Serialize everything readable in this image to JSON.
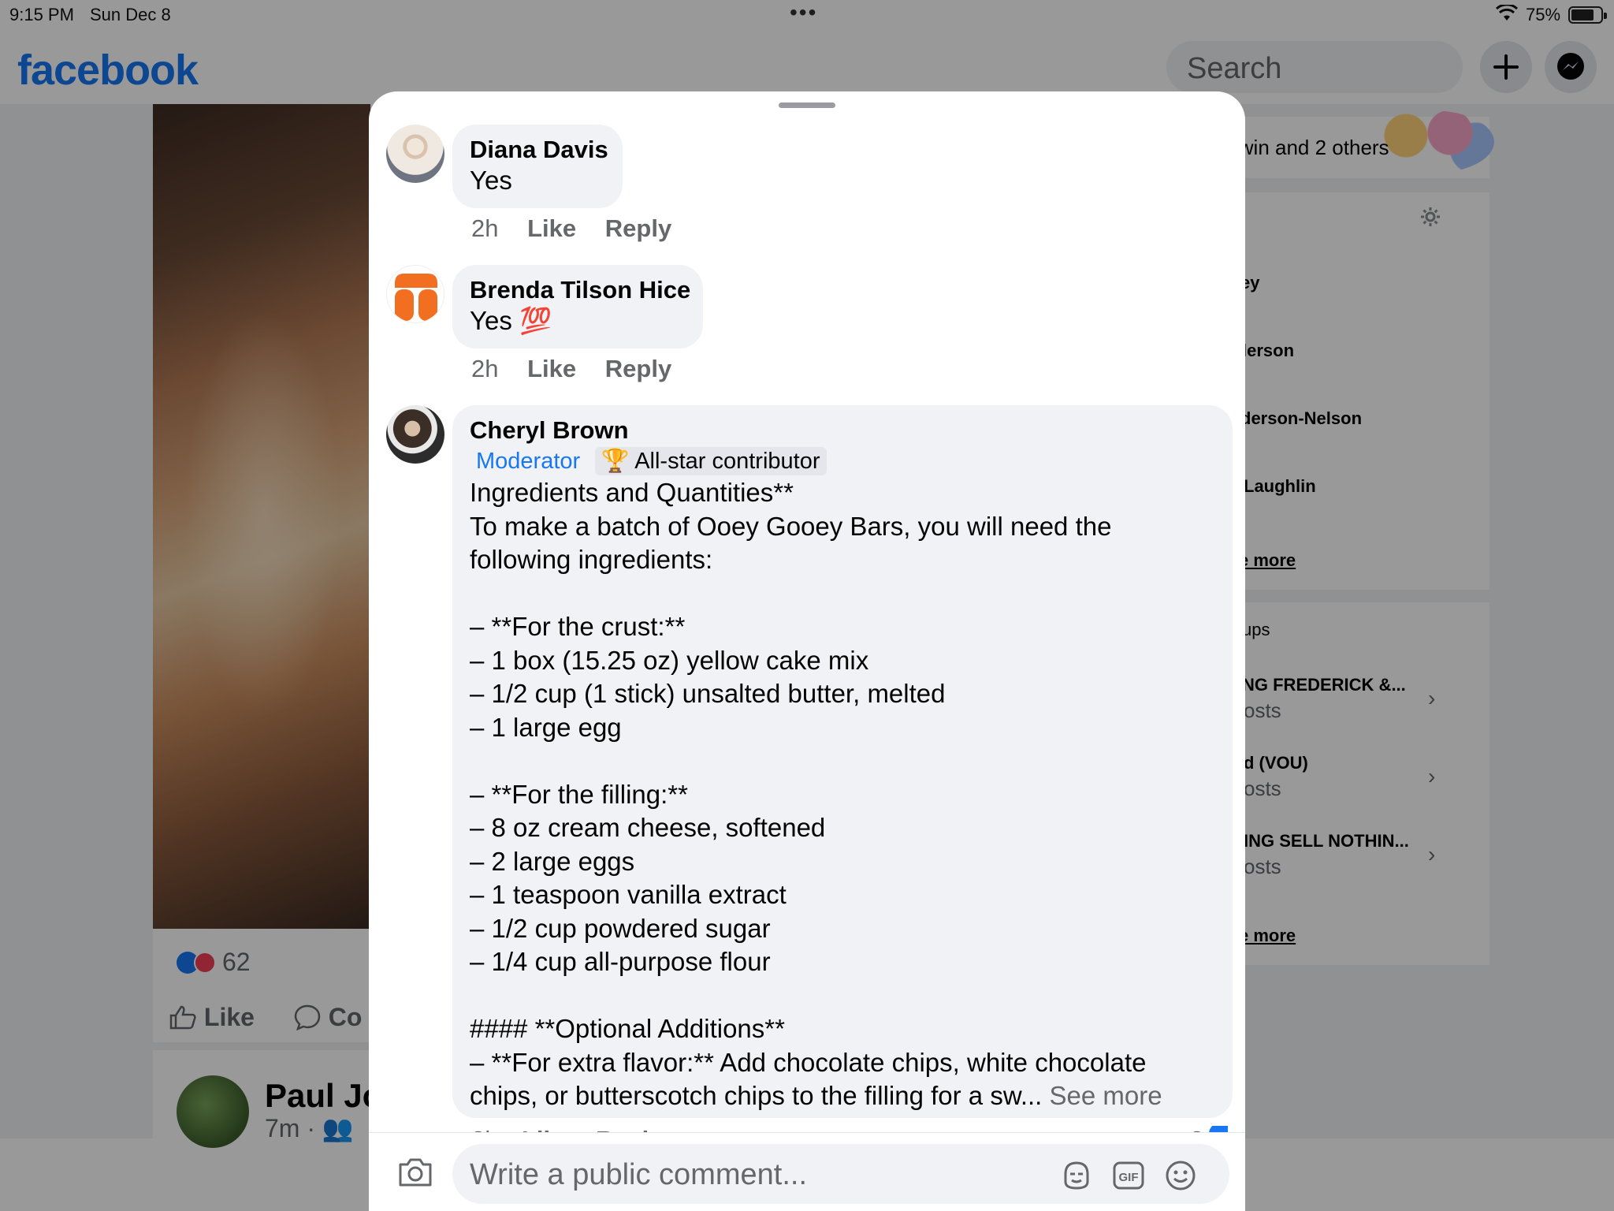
{
  "status_bar": {
    "time": "9:15 PM",
    "date": "Sun Dec 8",
    "battery": "75%"
  },
  "header": {
    "logo": "facebook",
    "search_placeholder": "Search"
  },
  "post": {
    "reaction_count": "62",
    "actions": {
      "like": "Like",
      "comment": "Co"
    },
    "next_author": "Paul Jo",
    "next_meta": "7m ·"
  },
  "right_column": {
    "birthdays_text": "lwin and 2 others",
    "contacts": [
      "ey",
      "lerson",
      "derson-Nelson",
      "Laughlin"
    ],
    "contacts_more": "e more",
    "groups_header": "ups",
    "groups": [
      {
        "name": "NG FREDERICK &...",
        "sub": "osts"
      },
      {
        "name": "d  (VOU)",
        "sub": "osts"
      },
      {
        "name": "ING SELL NOTHIN...",
        "sub": "osts"
      }
    ],
    "groups_more": "e more"
  },
  "comments": [
    {
      "name": "Diana Davis",
      "text": "Yes",
      "time": "2h",
      "like": "Like",
      "reply": "Reply"
    },
    {
      "name": "Brenda Tilson Hice",
      "text": "Yes 💯",
      "time": "2h",
      "like": "Like",
      "reply": "Reply"
    },
    {
      "name": "Cheryl Brown",
      "badge_moderator": "Moderator",
      "badge_allstar": "🏆 All-star contributor",
      "text": "Ingredients and Quantities**\nTo make a batch of Ooey Gooey Bars, you will need the following ingredients:\n\n– **For the crust:**\n– 1 box (15.25 oz) yellow cake mix\n– 1/2 cup (1 stick) unsalted butter, melted\n– 1 large egg\n\n– **For the filling:**\n– 8 oz cream cheese, softened\n– 2 large eggs\n– 1 teaspoon vanilla extract\n– 1/2 cup powdered sugar\n– 1/4 cup all-purpose flour\n\n#### **Optional Additions**\n– **For extra flavor:** Add chocolate chips, white chocolate chips, or butterscotch chips to the filling for a sw...",
      "see_more": "See more"
    }
  ],
  "composer": {
    "placeholder": "Write a public comment..."
  },
  "colors": {
    "brand": "#1877f2",
    "bubble": "#f0f2f5",
    "secondary_text": "#65676b"
  }
}
